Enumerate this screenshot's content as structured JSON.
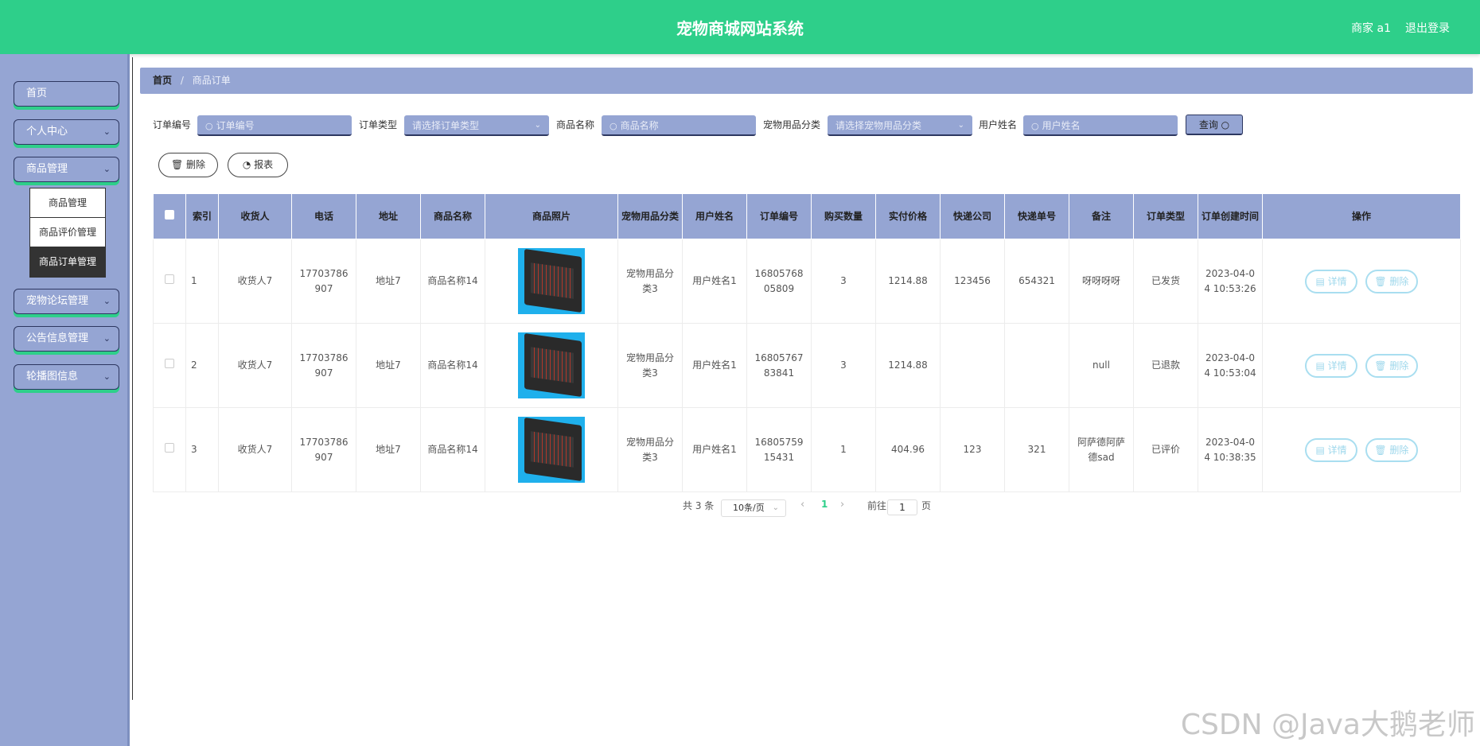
{
  "header": {
    "title": "宠物商城网站系统",
    "user": "商家 a1",
    "logout": "退出登录"
  },
  "sidebar": {
    "items": [
      {
        "label": "首页",
        "has_chevron": false
      },
      {
        "label": "个人中心",
        "has_chevron": true
      },
      {
        "label": "商品管理",
        "has_chevron": true
      },
      {
        "label": "宠物论坛管理",
        "has_chevron": true
      },
      {
        "label": "公告信息管理",
        "has_chevron": true
      },
      {
        "label": "轮播图信息",
        "has_chevron": true
      }
    ],
    "submenu": [
      {
        "label": "商品管理",
        "active": false
      },
      {
        "label": "商品评价管理",
        "active": false
      },
      {
        "label": "商品订单管理",
        "active": true
      }
    ]
  },
  "breadcrumb": {
    "home": "首页",
    "separator": "/",
    "current": "商品订单"
  },
  "search": {
    "order_no_label": "订单编号",
    "order_no_placeholder": "订单编号",
    "order_type_label": "订单类型",
    "order_type_placeholder": "请选择订单类型",
    "product_name_label": "商品名称",
    "product_name_placeholder": "商品名称",
    "category_label": "宠物用品分类",
    "category_placeholder": "请选择宠物用品分类",
    "user_name_label": "用户姓名",
    "user_name_placeholder": "用户姓名",
    "query_button": "查询"
  },
  "actions": {
    "delete": "删除",
    "report": "报表"
  },
  "table": {
    "columns": [
      "索引",
      "收货人",
      "电话",
      "地址",
      "商品名称",
      "商品照片",
      "宠物用品分类",
      "用户姓名",
      "订单编号",
      "购买数量",
      "实付价格",
      "快递公司",
      "快递单号",
      "备注",
      "订单类型",
      "订单创建时间",
      "操作"
    ],
    "rows": [
      {
        "index": "1",
        "receiver": "收货人7",
        "phone": "17703786907",
        "address": "地址7",
        "product": "商品名称14",
        "category": "宠物用品分类3",
        "user": "用户姓名1",
        "order_no": "1680576805809",
        "qty": "3",
        "price": "1214.88",
        "courier": "123456",
        "tracking": "654321",
        "note": "呀呀呀呀",
        "type": "已发货",
        "created": "2023-04-04 10:53:26"
      },
      {
        "index": "2",
        "receiver": "收货人7",
        "phone": "17703786907",
        "address": "地址7",
        "product": "商品名称14",
        "category": "宠物用品分类3",
        "user": "用户姓名1",
        "order_no": "1680576783841",
        "qty": "3",
        "price": "1214.88",
        "courier": "",
        "tracking": "",
        "note": "null",
        "type": "已退款",
        "created": "2023-04-04 10:53:04"
      },
      {
        "index": "3",
        "receiver": "收货人7",
        "phone": "17703786907",
        "address": "地址7",
        "product": "商品名称14",
        "category": "宠物用品分类3",
        "user": "用户姓名1",
        "order_no": "1680575915431",
        "qty": "1",
        "price": "404.96",
        "courier": "123",
        "tracking": "321",
        "note": "阿萨德阿萨德sad",
        "type": "已评价",
        "created": "2023-04-04 10:38:35"
      }
    ],
    "row_actions": {
      "detail": "详情",
      "delete": "删除"
    }
  },
  "pagination": {
    "total": "共 3 条",
    "page_size": "10条/页",
    "current_page": "1",
    "goto_label": "前往",
    "goto_value": "1",
    "page_unit": "页"
  },
  "watermark": "CSDN @Java大鹅老师",
  "colors": {
    "header": "#2ecf8a",
    "sidebar": "#95a5d3",
    "accent_border": "#2d3760"
  }
}
